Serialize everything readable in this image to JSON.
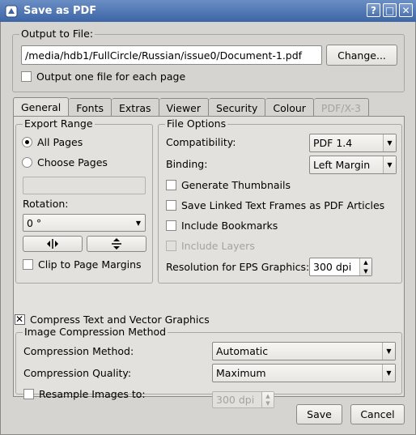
{
  "window": {
    "title": "Save as PDF",
    "controls": [
      "?",
      "□",
      "✕"
    ]
  },
  "output": {
    "group_title": "Output to File:",
    "path": "/media/hdb1/FullCircle/Russian/issue0/Document-1.pdf",
    "change_label": "Change...",
    "one_file_per_page_label": "Output one file for each page",
    "one_file_per_page_checked": false
  },
  "tabs": [
    {
      "label": "General",
      "active": true,
      "enabled": true
    },
    {
      "label": "Fonts",
      "active": false,
      "enabled": true
    },
    {
      "label": "Extras",
      "active": false,
      "enabled": true
    },
    {
      "label": "Viewer",
      "active": false,
      "enabled": true
    },
    {
      "label": "Security",
      "active": false,
      "enabled": true
    },
    {
      "label": "Colour",
      "active": false,
      "enabled": true
    },
    {
      "label": "PDF/X-3",
      "active": false,
      "enabled": false
    }
  ],
  "export_range": {
    "group_title": "Export Range",
    "all_pages_label": "All Pages",
    "choose_pages_label": "Choose Pages",
    "selected": "all_pages",
    "pages_value": "",
    "rotation_label": "Rotation:",
    "rotation_value": "0 °",
    "clip_label": "Clip to Page Margins",
    "clip_checked": false
  },
  "file_options": {
    "group_title": "File Options",
    "compatibility_label": "Compatibility:",
    "compatibility_value": "PDF 1.4",
    "binding_label": "Binding:",
    "binding_value": "Left Margin",
    "generate_thumbnails_label": "Generate Thumbnails",
    "save_linked_label": "Save Linked Text Frames as PDF Articles",
    "include_bookmarks_label": "Include Bookmarks",
    "include_layers_label": "Include Layers",
    "resolution_label": "Resolution for EPS Graphics:",
    "resolution_value": "300 dpi"
  },
  "compress_text_label": "Compress Text and Vector Graphics",
  "compress_text_checked": true,
  "image_compression": {
    "group_title": "Image Compression Method",
    "method_label": "Compression Method:",
    "method_value": "Automatic",
    "quality_label": "Compression Quality:",
    "quality_value": "Maximum",
    "resample_label": "Resample Images to:",
    "resample_checked": false,
    "resample_value": "300 dpi"
  },
  "footer": {
    "save_label": "Save",
    "cancel_label": "Cancel"
  }
}
